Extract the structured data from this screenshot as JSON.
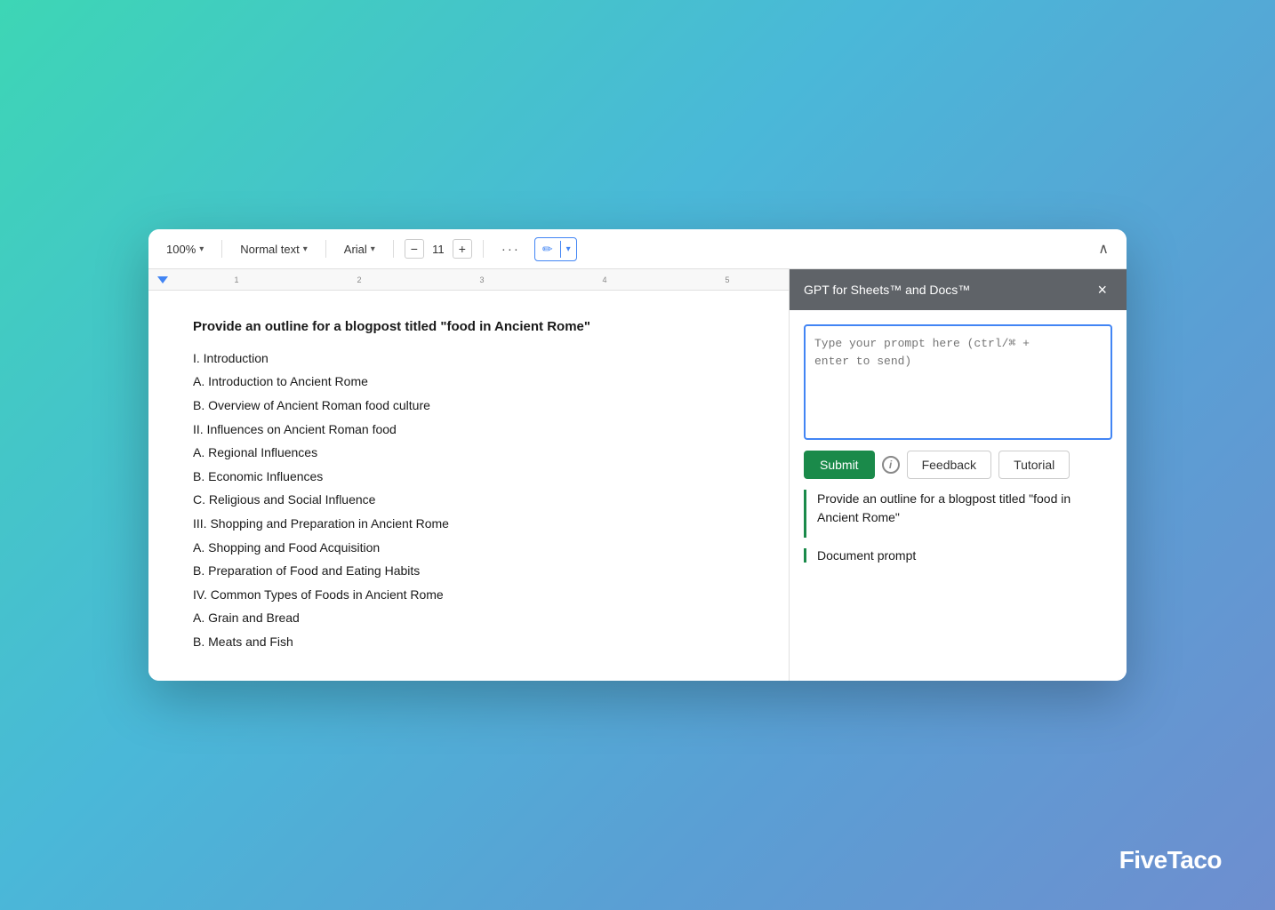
{
  "background": {
    "gradient": "linear-gradient(135deg, #3dd6b5 0%, #4ab8d8 40%, #5a9fd4 70%, #6e8ecf 100%)"
  },
  "logo": {
    "text": "FiveTaco"
  },
  "toolbar": {
    "zoom_label": "100%",
    "zoom_arrow": "▾",
    "text_style_label": "Normal text",
    "text_style_arrow": "▾",
    "font_label": "Arial",
    "font_arrow": "▾",
    "font_size_decrease": "−",
    "font_size_value": "11",
    "font_size_increase": "+",
    "more_options": "···",
    "pencil_icon": "✏",
    "collapse_icon": "∧"
  },
  "ruler": {
    "marks": [
      "1",
      "2",
      "3",
      "4",
      "5"
    ]
  },
  "document": {
    "heading": "Provide an outline for a blogpost titled \"food in Ancient Rome\"",
    "outline": [
      "I. Introduction",
      "A. Introduction to Ancient Rome",
      "B. Overview of Ancient Roman food culture",
      "II. Influences on Ancient Roman food",
      "A. Regional Influences",
      "B. Economic Influences",
      "C. Religious and Social Influence",
      "III. Shopping and Preparation in Ancient Rome",
      "A. Shopping and Food Acquisition",
      "B. Preparation of Food and Eating Habits",
      "IV. Common Types of Foods in Ancient Rome",
      "A. Grain and Bread",
      "B. Meats and Fish"
    ]
  },
  "sidebar": {
    "title": "GPT for Sheets™ and Docs™",
    "close_label": "×",
    "prompt_placeholder": "Type your prompt here (ctrl/⌘ +\nenter to send)",
    "submit_label": "Submit",
    "info_label": "i",
    "feedback_label": "Feedback",
    "tutorial_label": "Tutorial",
    "history_prompt": "Provide an outline for a blogpost titled \"food in Ancient Rome\"",
    "doc_prompt_label": "Document prompt"
  }
}
